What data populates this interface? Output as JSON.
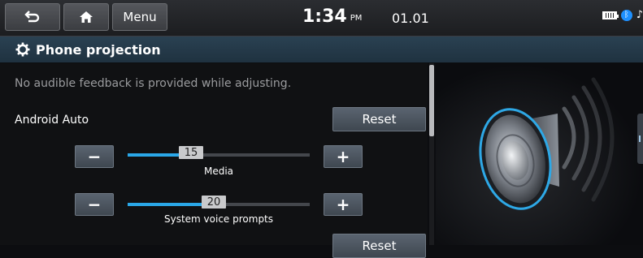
{
  "statusbar": {
    "menu_label": "Menu",
    "time": "1:34",
    "ampm": "PM",
    "date": "01.01",
    "icons": [
      "back-icon",
      "home-icon",
      "battery-icon",
      "bluetooth-icon",
      "music-note-icon"
    ]
  },
  "titlebar": {
    "title": "Phone projection",
    "icon": "gear-icon"
  },
  "main": {
    "notice": "No audible feedback is provided while adjusting.",
    "section_label": "Android Auto",
    "reset_label": "Reset",
    "reset_label_2": "Reset",
    "sliders": [
      {
        "label": "Media",
        "value": "15",
        "level": 0.375
      },
      {
        "label": "System voice prompts",
        "value": "20",
        "level": 0.5
      }
    ],
    "minus_glyph": "−",
    "plus_glyph": "+"
  },
  "colors": {
    "accent": "#2aa7e8",
    "titlebar": "#24394a",
    "background": "#0c0d10"
  }
}
